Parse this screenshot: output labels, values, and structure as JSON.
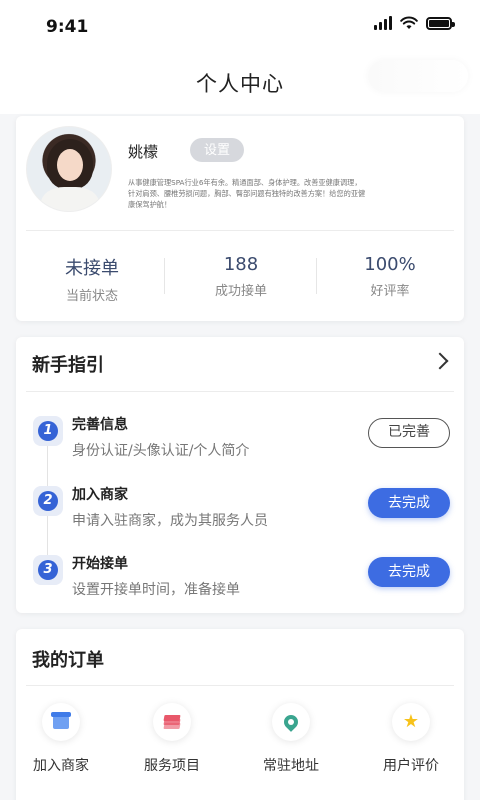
{
  "status_bar": {
    "time": "9:41"
  },
  "header": {
    "title": "个人中心"
  },
  "profile": {
    "name": "姚檬",
    "settings_label": "设置",
    "bio": "从事健康管理SPA行业6年有余。精通面部、身体护理。改善亚健康调理，针对肩颈、腰椎劳损问题，胸部、臀部问题有独特的改善方案！给您的亚健康保驾护航！",
    "stats": [
      {
        "value": "未接单",
        "label": "当前状态"
      },
      {
        "value": "188",
        "label": "成功接单"
      },
      {
        "value": "100%",
        "label": "好评率"
      }
    ]
  },
  "guide": {
    "title": "新手指引",
    "steps": [
      {
        "num": "1",
        "title": "完善信息",
        "desc": "身份认证/头像认证/个人简介",
        "action": "已完善"
      },
      {
        "num": "2",
        "title": "加入商家",
        "desc": "申请入驻商家，成为其服务人员",
        "action": "去完成"
      },
      {
        "num": "3",
        "title": "开始接单",
        "desc": "设置开接单时间，准备接单",
        "action": "去完成"
      }
    ]
  },
  "orders": {
    "title": "我的订单",
    "entries": [
      {
        "label": "加入商家",
        "icon": "shop-icon"
      },
      {
        "label": "服务项目",
        "icon": "layers-icon"
      },
      {
        "label": "常驻地址",
        "icon": "location-pin-icon"
      },
      {
        "label": "用户评价",
        "icon": "star-icon"
      }
    ]
  },
  "colors": {
    "primary": "#3d6ce2",
    "stat_value": "#3b4b6e",
    "background": "#f5f6f8"
  }
}
